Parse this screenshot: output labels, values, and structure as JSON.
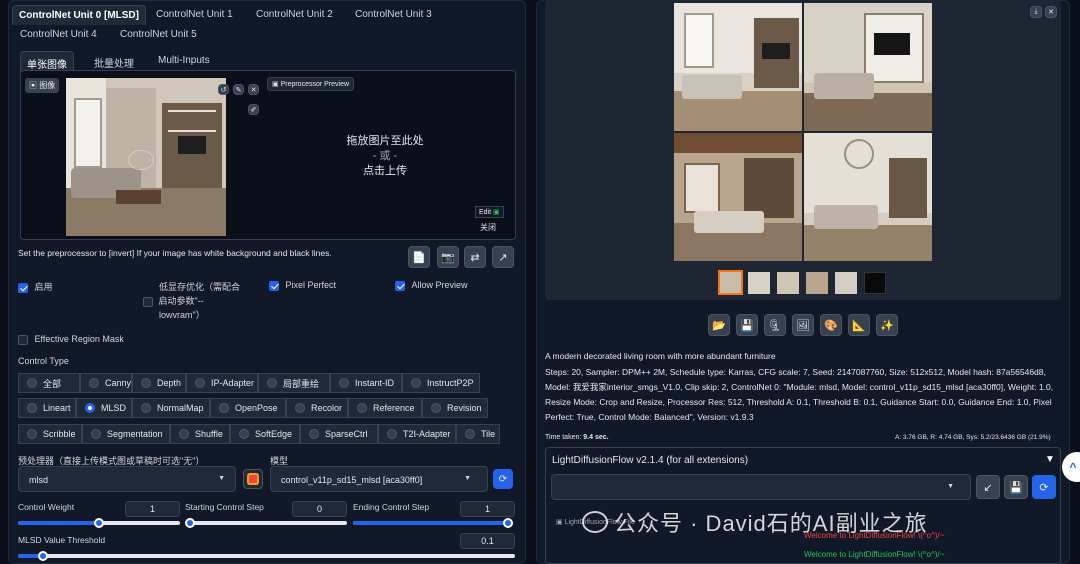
{
  "unit_tabs": [
    "ControlNet Unit 0 [MLSD]",
    "ControlNet Unit 1",
    "ControlNet Unit 2",
    "ControlNet Unit 3",
    "ControlNet Unit 4",
    "ControlNet Unit 5"
  ],
  "image_tabs": [
    "单张图像",
    "批量处理",
    "Multi-Inputs"
  ],
  "image_label": "图像",
  "preprocessor_preview_label": "Preprocessor Preview",
  "drop_zone": {
    "line1": "拖放图片至此处",
    "line2": "- 或 -",
    "line3": "点击上传"
  },
  "edit_label": "Edit",
  "close_label": "关闭",
  "hint": "Set the preprocessor to [invert] If your image has white background and black lines.",
  "options": {
    "enable": "启用",
    "low_vram_line1": "低显存优化（需配合",
    "low_vram_line2": "启动参数\"--",
    "low_vram_line3": "lowvram\"）",
    "pixel_perfect": "Pixel Perfect",
    "allow_preview": "Allow Preview",
    "effective_region_mask": "Effective Region Mask"
  },
  "control_type_label": "Control Type",
  "control_types": [
    "全部",
    "Canny",
    "Depth",
    "IP-Adapter",
    "局部重绘",
    "Instant-ID",
    "InstructP2P",
    "Lineart",
    "MLSD",
    "NormalMap",
    "OpenPose",
    "Recolor",
    "Reference",
    "Revision",
    "Scribble",
    "Segmentation",
    "Shuffle",
    "SoftEdge",
    "SparseCtrl",
    "T2I-Adapter",
    "Tile"
  ],
  "control_type_selected": "MLSD",
  "preprocessor_label": "预处理器（直接上传模式图或草稿时可选\"无\"）",
  "preprocessor_value": "mlsd",
  "model_label": "模型",
  "model_value": "control_v11p_sd15_mlsd [aca30ff0]",
  "sliders": {
    "control_weight_label": "Control Weight",
    "control_weight": "1",
    "control_weight_frac": 0.5,
    "start_label": "Starting Control Step",
    "start": "0",
    "start_frac": 0.0,
    "end_label": "Ending Control Step",
    "end": "1",
    "end_frac": 1.0,
    "mlsd_label": "MLSD Value Threshold",
    "mlsd": "0.1",
    "mlsd_frac": 0.05
  },
  "prompt": "A modern decorated living room with more abundant furniture",
  "gen_info": "Steps: 20, Sampler: DPM++ 2M, Schedule type: Karras, CFG scale: 7, Seed: 2147087760, Size: 512x512, Model hash: 87a56546d8, Model: 我爱我家interior_smgs_V1.0, Clip skip: 2, ControlNet 0: \"Module: mlsd, Model: control_v11p_sd15_mlsd [aca30ff0], Weight: 1.0, Resize Mode: Crop and Resize, Processor Res: 512, Threshold A: 0.1, Threshold B: 0.1, Guidance Start: 0.0, Guidance End: 1.0, Pixel Perfect: True, Control Mode: Balanced\", Version: v1.9.3",
  "time_taken_label": "Time taken:",
  "time_taken": "9.4 sec.",
  "vram": "A: 3.76 GB, R: 4.74 GB, Sys: 5.2/23.6436 GB (21.9%)",
  "ldf": {
    "title": "LightDiffusionFlow v2.1.4 (for all extensions)",
    "file_label": "LightDiffusionFlow File",
    "msg1": "Welcome to LightDiffusionFlow! \\(^o^)/~",
    "msg2": "Welcome to LightDiffusionFlow! \\(^o^)/~"
  },
  "watermark": "公众号 · David石的AI副业之旅",
  "colors": {
    "accent": "#2563eb",
    "tab_active_text": "#ffffff",
    "green_msg": "#22c55e",
    "red_msg": "#ef4444"
  }
}
